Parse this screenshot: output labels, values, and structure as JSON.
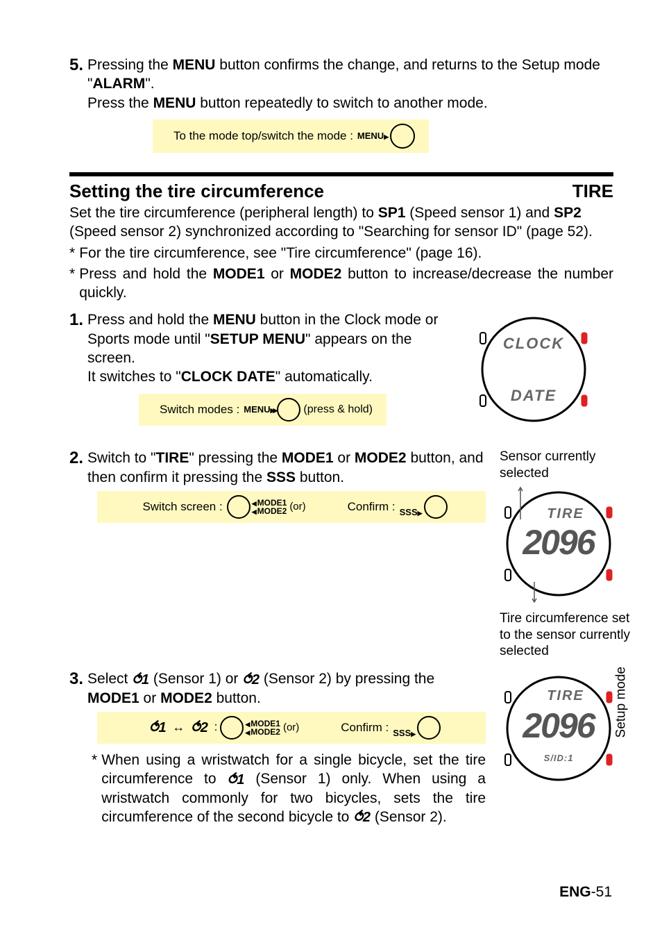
{
  "step5": {
    "num": "5.",
    "line1a": "Pressing the ",
    "menu": "MENU",
    "line1b": " button confirms the change, and returns to the Setup mode \"",
    "alarm": "ALARM",
    "line1c": "\".",
    "line2a": "Press the ",
    "line2b": " button repeatedly to switch to another mode."
  },
  "hint_top": {
    "label": "To the mode top/switch the mode :",
    "btn": "MENU"
  },
  "section": {
    "title": "Setting the tire circumference",
    "tag": "TIRE"
  },
  "intro": {
    "a": "Set the tire circumference (peripheral length) to ",
    "sp1": "SP1",
    "b": " (Speed sensor 1) and ",
    "sp2": "SP2",
    "c": " (Speed sensor 2) synchronized according to \"Searching for sensor ID\" (page 52)."
  },
  "note1": "For the tire circumference, see \"Tire circumference\" (page 16).",
  "note2": {
    "a": "Press and hold the ",
    "m1": "MODE1",
    "or": " or ",
    "m2": "MODE2",
    "b": " button to increase/decrease the number quickly."
  },
  "step1": {
    "num": "1.",
    "a": "Press and hold the ",
    "menu": "MENU",
    "b": " button in the Clock mode or Sports mode until \"",
    "setup": "SETUP MENU",
    "c": "\" appears on the screen.",
    "d": "It switches to \"",
    "clock": "CLOCK DATE",
    "e": "\" automatically."
  },
  "hint1": {
    "label": "Switch modes :",
    "btn": "MENU",
    "suffix": "(press & hold)"
  },
  "watch1": {
    "top": "CLOCK",
    "bottom": "DATE"
  },
  "step2": {
    "num": "2.",
    "a": "Switch to \"",
    "tire": "TIRE",
    "b": "\" pressing the ",
    "m1": "MODE1",
    "or": " or ",
    "m2": "MODE2",
    "c": " button, and then confirm it pressing the ",
    "sss": "SSS",
    "d": " button."
  },
  "hint2": {
    "label": "Switch screen :",
    "m1": "MODE1",
    "m2": "MODE2",
    "or": "(or)",
    "conf": "Confirm :",
    "sss": "SSS"
  },
  "cap2a": "Sensor currently selected",
  "watch2": {
    "top": "TIRE",
    "big": "2096"
  },
  "cap2b": "Tire circumference set to the sensor currently selected",
  "step3": {
    "num": "3.",
    "a": "Select ",
    "s1": "1",
    "b": " (Sensor 1) or ",
    "s2": "2",
    "c": " (Sensor 2) by pressing the ",
    "m1": "MODE1",
    "or2": "or ",
    "m2": "MODE2",
    "d": " button."
  },
  "hint3": {
    "s1": "1",
    "s2": "2",
    "m1": "MODE1",
    "m2": "MODE2",
    "or": "(or)",
    "conf": "Confirm :",
    "sss": "SSS"
  },
  "watch3": {
    "top": "TIRE",
    "big": "2096",
    "bottom": "S/ID:1"
  },
  "note3": {
    "a": "When using a wristwatch for a single bicycle, set the tire circumference to ",
    "s1": "1",
    "b": " (Sensor 1) only. When using a wristwatch commonly for two bicycles, sets the tire circumference of the second bicycle to ",
    "s2": "2",
    "c": " (Sensor 2)."
  },
  "sidetab": "Setup mode",
  "footer": {
    "eng": "ENG",
    "page": "-51"
  }
}
